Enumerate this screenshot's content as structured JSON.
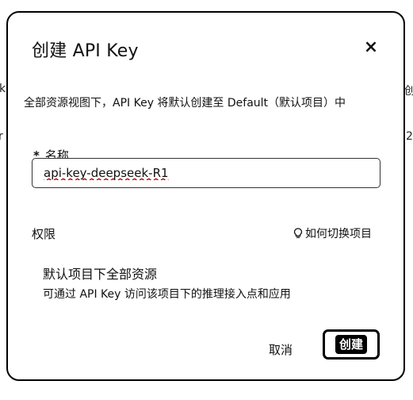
{
  "background": {
    "frag_left_top": "k",
    "frag_left_bottom": "r",
    "frag_right_top": "创",
    "frag_right_bottom": "2"
  },
  "dialog": {
    "title": "创建 API Key",
    "close_icon": "×",
    "notice": "全部资源视图下，API Key 将默认创建至 Default（默认项目）中",
    "name_field": {
      "required_mark": "*",
      "label": "名称",
      "value": "api-key-deepseek-R1"
    },
    "permissions": {
      "label": "权限",
      "help_link": "如何切换项目",
      "help_icon": "lightbulb-icon",
      "scope_title": "默认项目下全部资源",
      "scope_description": "可通过 API Key 访问该项目下的推理接入点和应用"
    },
    "footer": {
      "cancel_label": "取消",
      "create_label": "创建"
    }
  }
}
